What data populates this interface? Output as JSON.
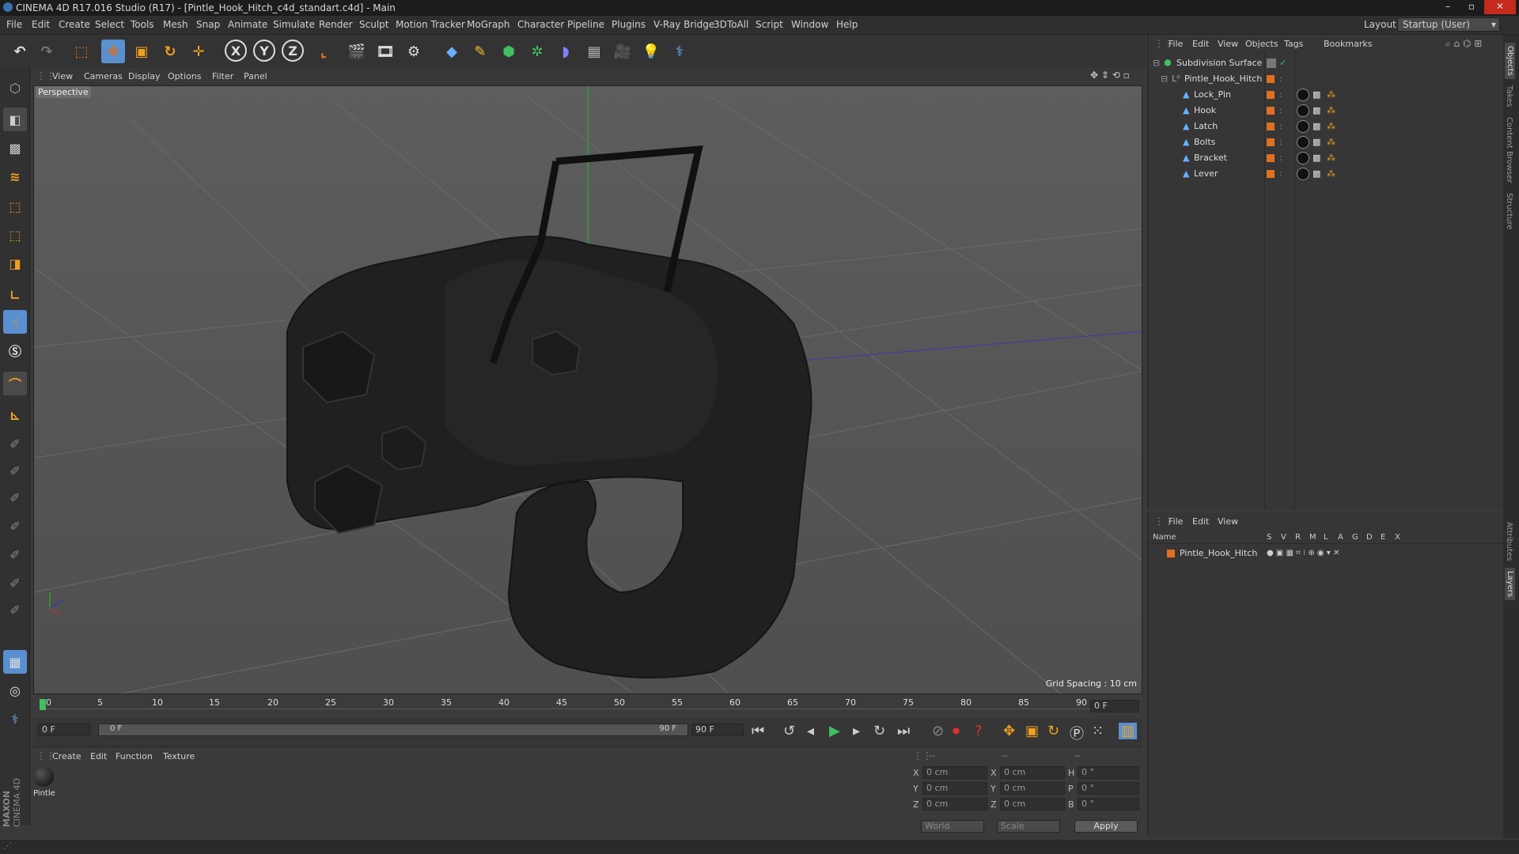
{
  "window": {
    "title": "CINEMA 4D R17.016 Studio (R17) - [Pintle_Hook_Hitch_c4d_standart.c4d] - Main",
    "minimize": "–",
    "maximize": "▫",
    "close": "✕"
  },
  "menubar": {
    "items": [
      "File",
      "Edit",
      "Create",
      "Select",
      "Tools",
      "Mesh",
      "Snap",
      "Animate",
      "Simulate",
      "Render",
      "Sculpt",
      "Motion Tracker",
      "MoGraph",
      "Character",
      "Pipeline",
      "Plugins",
      "V-Ray Bridge",
      "3DToAll",
      "Script",
      "Window",
      "Help"
    ],
    "layout_label": "Layout:",
    "layout_value": "Startup (User)"
  },
  "toolbar": {
    "x_label": "X",
    "y_label": "Y",
    "z_label": "Z"
  },
  "viewport": {
    "menu": [
      "View",
      "Cameras",
      "Display",
      "Options",
      "Filter",
      "Panel"
    ],
    "label": "Perspective",
    "grid_spacing": "Grid Spacing : 10 cm"
  },
  "timeline": {
    "ticks": [
      "0",
      "5",
      "10",
      "15",
      "20",
      "25",
      "30",
      "35",
      "40",
      "45",
      "50",
      "55",
      "60",
      "65",
      "70",
      "75",
      "80",
      "85",
      "90"
    ],
    "current_frame_box": "0 F",
    "start_field": "0 F",
    "range_start": "0 F",
    "range_end": "90 F",
    "end_field": "90 F"
  },
  "material_panel": {
    "menu": [
      "Create",
      "Edit",
      "Function",
      "Texture"
    ],
    "material_name": "Pintle"
  },
  "coords": {
    "headers": [
      "--",
      "--",
      "--"
    ],
    "rows": [
      {
        "axis": "X",
        "pos": "0 cm",
        "axis2": "X",
        "size": "0 cm",
        "rot_label": "H",
        "rot": "0 °"
      },
      {
        "axis": "Y",
        "pos": "0 cm",
        "axis2": "Y",
        "size": "0 cm",
        "rot_label": "P",
        "rot": "0 °"
      },
      {
        "axis": "Z",
        "pos": "0 cm",
        "axis2": "Z",
        "size": "0 cm",
        "rot_label": "B",
        "rot": "0 °"
      }
    ],
    "world": "World",
    "scale": "Scale",
    "apply": "Apply"
  },
  "object_manager": {
    "menu": [
      "File",
      "Edit",
      "View",
      "Objects",
      "Tags",
      "Bookmarks"
    ],
    "objects": [
      {
        "name": "Subdivision Surface",
        "level": 0
      },
      {
        "name": "Pintle_Hook_Hitch",
        "level": 1
      },
      {
        "name": "Lock_Pin",
        "level": 2
      },
      {
        "name": "Hook",
        "level": 2
      },
      {
        "name": "Latch",
        "level": 2
      },
      {
        "name": "Bolts",
        "level": 2
      },
      {
        "name": "Bracket",
        "level": 2
      },
      {
        "name": "Lever",
        "level": 2
      }
    ]
  },
  "layer_manager": {
    "menu": [
      "File",
      "Edit",
      "View"
    ],
    "columns": [
      "Name",
      "S",
      "V",
      "R",
      "M",
      "L",
      "A",
      "G",
      "D",
      "E",
      "X"
    ],
    "layer_name": "Pintle_Hook_Hitch"
  },
  "side_tabs": [
    "Objects",
    "Takes",
    "Content Browser",
    "Structure"
  ],
  "side_tabs_lower": [
    "Attributes",
    "Layers"
  ],
  "brand": {
    "maxon": "MAXON",
    "product": "CINEMA 4D"
  },
  "colors": {
    "accent": "#e07020",
    "highlight": "#5a8fd0"
  }
}
